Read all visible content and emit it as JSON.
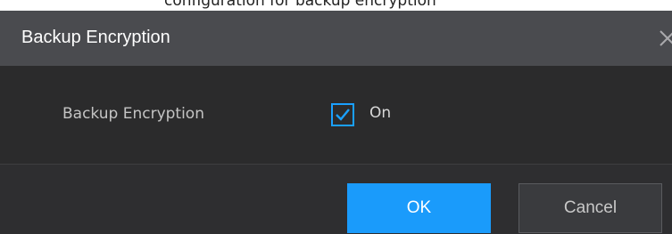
{
  "top_cutoff_text": "configuration for backup encryption",
  "dialog": {
    "title": "Backup Encryption",
    "close_icon": "close-icon",
    "field": {
      "label": "Backup Encryption",
      "checked": true,
      "checkbox_label": "On"
    },
    "buttons": {
      "ok_label": "OK",
      "cancel_label": "Cancel"
    }
  },
  "colors": {
    "accent": "#1a9bfb",
    "titlebar": "#4a4b4f",
    "body": "#2b2b2c"
  }
}
